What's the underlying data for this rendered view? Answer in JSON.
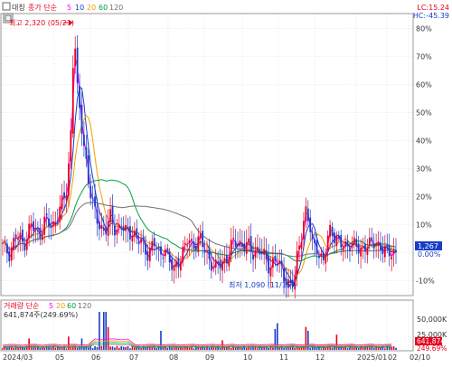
{
  "header": {
    "toggle_label": "대칭",
    "legend_title": "종가 단순",
    "ma_periods": [
      "5",
      "10",
      "20",
      "60",
      "120"
    ],
    "lc_label": "LC:15.24",
    "hc_label": "HC:-45.39"
  },
  "annotations": {
    "high": "최고 2,320 (05/21)",
    "low": "최저 1,090 (11/15)"
  },
  "price_axis": {
    "ticks": [
      "80%",
      "70%",
      "60%",
      "50%",
      "40%",
      "30%",
      "20%",
      "10%",
      "0.00%",
      "-10%"
    ],
    "current_price": "1,267",
    "current_pct": "0.00%"
  },
  "volume_panel": {
    "legend_title": "거래량 단순",
    "ma_periods": [
      "5",
      "20",
      "60",
      "120"
    ],
    "current_volume": "641,874주(249.69%)",
    "ticks": [
      "50,000K",
      "25,000K"
    ],
    "last_value_badge": "641,874",
    "last_pct": "249.69%"
  },
  "x_axis": {
    "labels": [
      "2024/03",
      "05",
      "06",
      "07",
      "08",
      "09",
      "10",
      "11",
      "12",
      "2025/01",
      "02",
      "02/10"
    ]
  },
  "colors": {
    "up": "#e8001c",
    "down": "#1a3cc8",
    "ma5": "#ff00ff",
    "ma10": "#1a3cc8",
    "ma20": "#f0a000",
    "ma60": "#00a040",
    "ma120": "#707070",
    "grid": "#d8d8d8",
    "current_badge": "#1a3cc8"
  },
  "chart_data": {
    "type": "candlestick",
    "y_unit": "% change",
    "ylim": [
      -15,
      85
    ],
    "x_start_label": "2024/03",
    "x_end_label": "02/10",
    "high_point": {
      "date": "05/21",
      "price": 2320,
      "pct": 82
    },
    "low_point": {
      "date": "11/15",
      "price": 1090,
      "pct": -13
    },
    "last_close_pct": 0,
    "price_series": [
      {
        "month": "2024/03",
        "close_pct": 2
      },
      {
        "month": "05-start",
        "close_pct": 10
      },
      {
        "month": "05-21",
        "close_pct": 82
      },
      {
        "month": "06",
        "close_pct": 35
      },
      {
        "month": "06-late",
        "close_pct": 12
      },
      {
        "month": "07",
        "close_pct": 10
      },
      {
        "month": "08",
        "close_pct": 2
      },
      {
        "month": "08-late",
        "close_pct": -7
      },
      {
        "month": "09",
        "close_pct": -4
      },
      {
        "month": "10",
        "close_pct": 3
      },
      {
        "month": "11",
        "close_pct": -2
      },
      {
        "month": "11-15",
        "close_pct": -13
      },
      {
        "month": "11-late",
        "close_pct": 15
      },
      {
        "month": "12",
        "close_pct": 4
      },
      {
        "month": "2025/01",
        "close_pct": 2
      },
      {
        "month": "02",
        "close_pct": 0
      }
    ],
    "volume_ylim_k": [
      0,
      60000
    ],
    "volume_ticks_k": [
      50000,
      25000
    ],
    "volume_last_k": 641.874
  }
}
